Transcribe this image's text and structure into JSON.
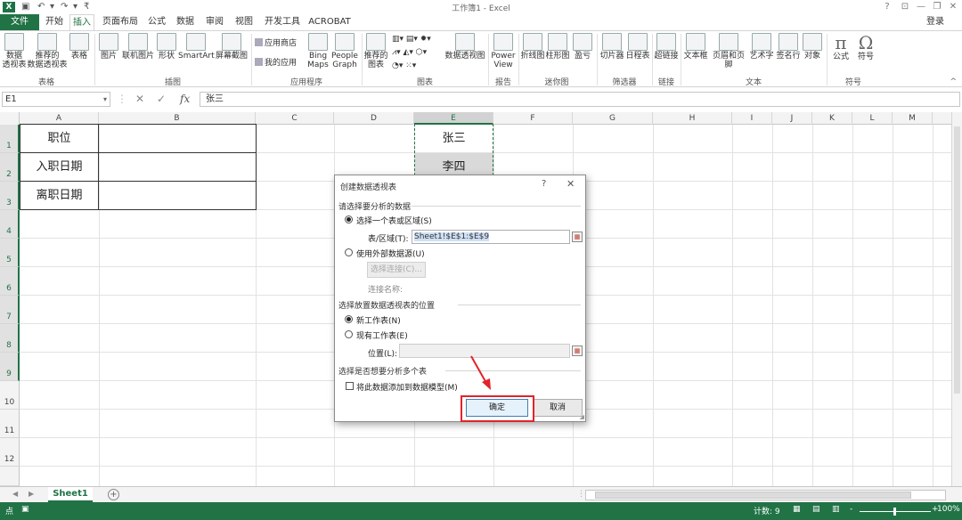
{
  "window": {
    "title": "工作簿1 - Excel",
    "logo": "X",
    "qat_icons": [
      "save-icon",
      "undo-icon",
      "redo-icon",
      "customize-icon"
    ],
    "help_glyph": "?",
    "minimize_glyph": "—",
    "restore_glyph": "❐",
    "close_glyph": "✕"
  },
  "tabs": {
    "file": "文件",
    "items": [
      "开始",
      "插入",
      "页面布局",
      "公式",
      "数据",
      "审阅",
      "视图",
      "开发工具",
      "ACROBAT"
    ],
    "active": "插入",
    "login": "登录"
  },
  "ribbon": {
    "buttons": {
      "pivot_table": "数据\n透视表",
      "recommended_pivot": "推荐的\n数据透视表",
      "table": "表格",
      "pictures": "图片",
      "online_pictures": "联机图片",
      "shapes": "形状",
      "smartart": "SmartArt",
      "screenshot": "屏幕截图",
      "app_store": "应用商店",
      "my_apps": "我的应用",
      "bing_maps": "Bing\nMaps",
      "people_graph": "People\nGraph",
      "recommended_charts": "推荐的\n图表",
      "pivot_chart": "数据透视图",
      "power_view": "Power\nView",
      "line": "折线图",
      "column": "柱形图",
      "win_loss": "盈亏",
      "slicer": "切片器",
      "timeline": "日程表",
      "hyperlink": "超链接",
      "textbox": "文本框",
      "header_footer": "页眉和页脚",
      "wordart": "艺术字",
      "signature": "签名行",
      "object": "对象",
      "equation": "公式",
      "symbol": "符号",
      "equation_glyph": "π",
      "symbol_glyph": "Ω"
    },
    "groups": [
      "表格",
      "插图",
      "应用程序",
      "图表",
      "报告",
      "迷你图",
      "筛选器",
      "链接",
      "文本",
      "符号"
    ],
    "collapse_glyph": "^"
  },
  "formula_bar": {
    "name_box": "E1",
    "cancel_glyph": "✕",
    "confirm_glyph": "✓",
    "fx": "fx",
    "content": "张三"
  },
  "grid": {
    "columns": [
      "A",
      "B",
      "C",
      "D",
      "E",
      "F",
      "G",
      "H",
      "I",
      "J",
      "K",
      "L",
      "M"
    ],
    "selected_column": "E",
    "rows": [
      "1",
      "2",
      "3",
      "4",
      "5",
      "6",
      "7",
      "8",
      "9",
      "10",
      "11",
      "12"
    ],
    "cells": {
      "A1": "职位",
      "A2": "入职日期",
      "A3": "离职日期",
      "E1": "张三",
      "E2": "李四"
    }
  },
  "dialog": {
    "title": "创建数据透视表",
    "help": "?",
    "close": "✕",
    "section1": "请选择要分析的数据",
    "opt_select_range": "选择一个表或区域(S)",
    "range_label": "表/区域(T):",
    "range_value": "Sheet1!$E$1:$E$9",
    "opt_external": "使用外部数据源(U)",
    "choose_connection": "选择连接(C)...",
    "connection_name_label": "连接名称:",
    "section2": "选择放置数据透视表的位置",
    "opt_new_sheet": "新工作表(N)",
    "opt_existing_sheet": "现有工作表(E)",
    "location_label": "位置(L):",
    "location_value": "",
    "section3": "选择是否想要分析多个表",
    "add_to_model": "将此数据添加到数据模型(M)",
    "ok": "确定",
    "cancel": "取消",
    "highlight_color": "#e2232a"
  },
  "sheet_tabs": {
    "sheets": [
      "Sheet1"
    ],
    "add_glyph": "+",
    "nav_left": "◀",
    "nav_right": "▶"
  },
  "status": {
    "ready": "点",
    "count": "计数: 9",
    "zoom": "100%",
    "zoom_minus": "-",
    "zoom_plus": "+"
  },
  "colors": {
    "accent": "#217346",
    "status_bg": "#217346",
    "arrow": "#e2232a"
  }
}
